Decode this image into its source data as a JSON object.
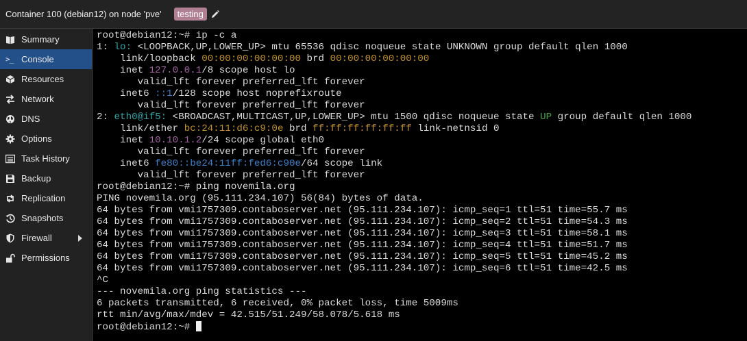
{
  "header": {
    "title": "Container 100 (debian12) on node 'pve'",
    "tag": "testing"
  },
  "sidebar": {
    "items": [
      {
        "label": "Summary"
      },
      {
        "label": "Console",
        "glyph": ">_"
      },
      {
        "label": "Resources"
      },
      {
        "label": "Network"
      },
      {
        "label": "DNS"
      },
      {
        "label": "Options"
      },
      {
        "label": "Task History"
      },
      {
        "label": "Backup"
      },
      {
        "label": "Replication"
      },
      {
        "label": "Snapshots"
      },
      {
        "label": "Firewall"
      },
      {
        "label": "Permissions"
      }
    ]
  },
  "terminal": {
    "lines": [
      [
        {
          "t": "root@debian12:~# ip -c a"
        }
      ],
      [
        {
          "t": "1: "
        },
        {
          "t": "lo:",
          "c": "c-cyan"
        },
        {
          "t": " <LOOPBACK,UP,LOWER_UP> mtu 65536 qdisc noqueue state UNKNOWN group default qlen 1000"
        }
      ],
      [
        {
          "t": "    link/loopback "
        },
        {
          "t": "00:00:00:00:00:00",
          "c": "c-orange"
        },
        {
          "t": " brd "
        },
        {
          "t": "00:00:00:00:00:00",
          "c": "c-orange"
        }
      ],
      [
        {
          "t": "    inet "
        },
        {
          "t": "127.0.0.1",
          "c": "c-purple"
        },
        {
          "t": "/8 scope host lo"
        }
      ],
      [
        {
          "t": "       valid_lft forever preferred_lft forever"
        }
      ],
      [
        {
          "t": "    inet6 "
        },
        {
          "t": "::1",
          "c": "c-blue"
        },
        {
          "t": "/128 scope host noprefixroute"
        }
      ],
      [
        {
          "t": "       valid_lft forever preferred_lft forever"
        }
      ],
      [
        {
          "t": "2: "
        },
        {
          "t": "eth0@if5:",
          "c": "c-cyan"
        },
        {
          "t": " <BROADCAST,MULTICAST,UP,LOWER_UP> mtu 1500 qdisc noqueue state "
        },
        {
          "t": "UP",
          "c": "c-green"
        },
        {
          "t": " group default qlen 1000"
        }
      ],
      [
        {
          "t": "    link/ether "
        },
        {
          "t": "bc:24:11:d6:c9:0e",
          "c": "c-orange"
        },
        {
          "t": " brd "
        },
        {
          "t": "ff:ff:ff:ff:ff:ff",
          "c": "c-orange"
        },
        {
          "t": " link-netnsid 0"
        }
      ],
      [
        {
          "t": "    inet "
        },
        {
          "t": "10.10.1.2",
          "c": "c-purple"
        },
        {
          "t": "/24 scope global eth0"
        }
      ],
      [
        {
          "t": "       valid_lft forever preferred_lft forever"
        }
      ],
      [
        {
          "t": "    inet6 "
        },
        {
          "t": "fe80::be24:11ff:fed6:c90e",
          "c": "c-blue"
        },
        {
          "t": "/64 scope link"
        }
      ],
      [
        {
          "t": "       valid_lft forever preferred_lft forever"
        }
      ],
      [
        {
          "t": "root@debian12:~# ping novemila.org"
        }
      ],
      [
        {
          "t": "PING novemila.org (95.111.234.107) 56(84) bytes of data."
        }
      ],
      [
        {
          "t": "64 bytes from vmi1757309.contaboserver.net (95.111.234.107): icmp_seq=1 ttl=51 time=55.7 ms"
        }
      ],
      [
        {
          "t": "64 bytes from vmi1757309.contaboserver.net (95.111.234.107): icmp_seq=2 ttl=51 time=54.3 ms"
        }
      ],
      [
        {
          "t": "64 bytes from vmi1757309.contaboserver.net (95.111.234.107): icmp_seq=3 ttl=51 time=58.1 ms"
        }
      ],
      [
        {
          "t": "64 bytes from vmi1757309.contaboserver.net (95.111.234.107): icmp_seq=4 ttl=51 time=51.7 ms"
        }
      ],
      [
        {
          "t": "64 bytes from vmi1757309.contaboserver.net (95.111.234.107): icmp_seq=5 ttl=51 time=45.2 ms"
        }
      ],
      [
        {
          "t": "64 bytes from vmi1757309.contaboserver.net (95.111.234.107): icmp_seq=6 ttl=51 time=42.5 ms"
        }
      ],
      [
        {
          "t": "^C"
        }
      ],
      [
        {
          "t": "--- novemila.org ping statistics ---"
        }
      ],
      [
        {
          "t": "6 packets transmitted, 6 received, 0% packet loss, time 5009ms"
        }
      ],
      [
        {
          "t": "rtt min/avg/max/mdev = 42.515/51.249/58.078/5.618 ms"
        }
      ],
      [
        {
          "t": "root@debian12:~# "
        }
      ]
    ]
  }
}
